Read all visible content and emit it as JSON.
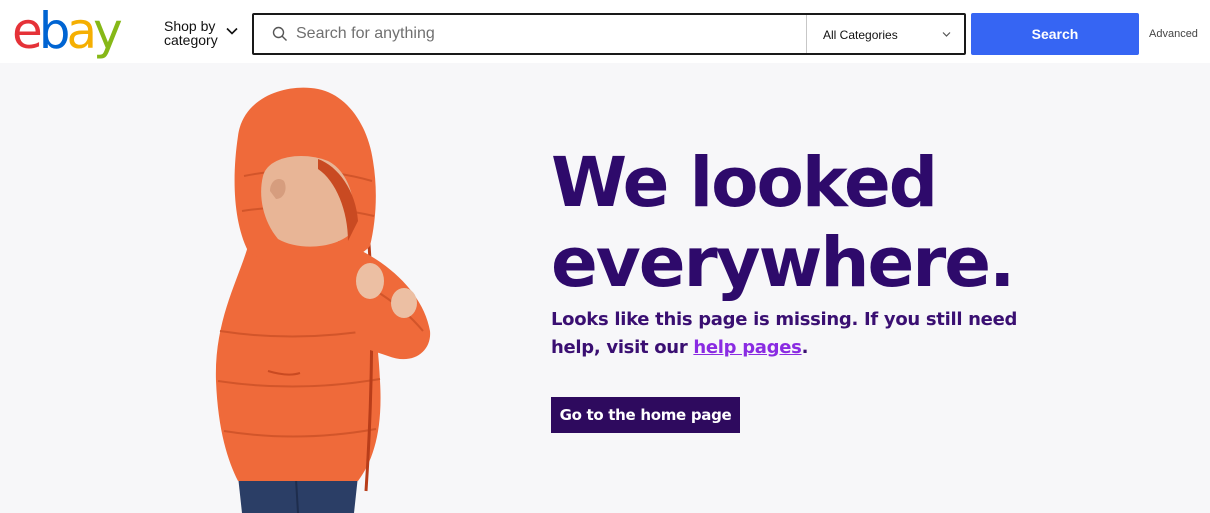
{
  "header": {
    "logo_letters": [
      {
        "char": "e",
        "color": "#e53238"
      },
      {
        "char": "b",
        "color": "#0064d2"
      },
      {
        "char": "a",
        "color": "#f5af02"
      },
      {
        "char": "y",
        "color": "#86b817"
      }
    ],
    "shop_by_line1": "Shop by",
    "shop_by_line2": "category",
    "search_placeholder": "Search for anything",
    "search_value": "",
    "category_selected": "All Categories",
    "search_button": "Search",
    "advanced_link": "Advanced"
  },
  "hero": {
    "headline_line1": "We looked",
    "headline_line2": "everywhere.",
    "sub_prefix": "Looks like this page is missing. If you still need help, visit our ",
    "help_link": "help pages",
    "sub_suffix": ".",
    "home_button": "Go to the home page"
  },
  "colors": {
    "accent_blue": "#3665f3",
    "headline_purple": "#2e0a6b",
    "link_purple": "#8a2be2",
    "hero_bg": "#f7f7f9",
    "jacket_orange": "#ef6a3a"
  },
  "icons": {
    "search": "search-icon",
    "shop_chevron": "chevron-down-icon",
    "category_chevron": "chevron-down-icon"
  }
}
